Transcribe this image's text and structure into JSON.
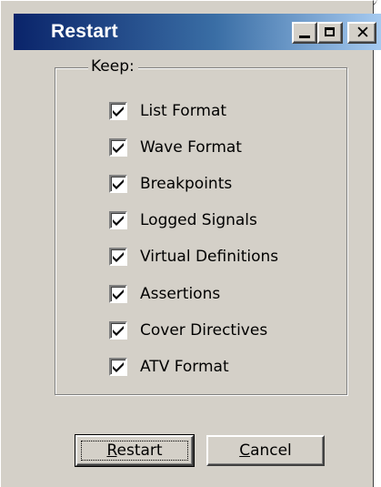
{
  "window": {
    "title": "Restart",
    "controls": {
      "minimize_icon": "minimize-icon",
      "maximize_icon": "maximize-icon",
      "close_glyph": "✕"
    }
  },
  "group": {
    "legend": "Keep:"
  },
  "options": [
    {
      "label": "List Format",
      "checked": true
    },
    {
      "label": "Wave Format",
      "checked": true
    },
    {
      "label": "Breakpoints",
      "checked": true
    },
    {
      "label": "Logged Signals",
      "checked": true
    },
    {
      "label": "Virtual Definitions",
      "checked": true
    },
    {
      "label": "Assertions",
      "checked": true
    },
    {
      "label": "Cover Directives",
      "checked": true
    },
    {
      "label": "ATV Format",
      "checked": true
    }
  ],
  "buttons": {
    "restart": {
      "mnemonic": "R",
      "rest": "estart"
    },
    "cancel": {
      "mnemonic": "C",
      "rest": "ancel"
    }
  },
  "colors": {
    "title_start": "#0a246a",
    "title_end": "#a6caf0",
    "face": "#d4d0c8"
  }
}
